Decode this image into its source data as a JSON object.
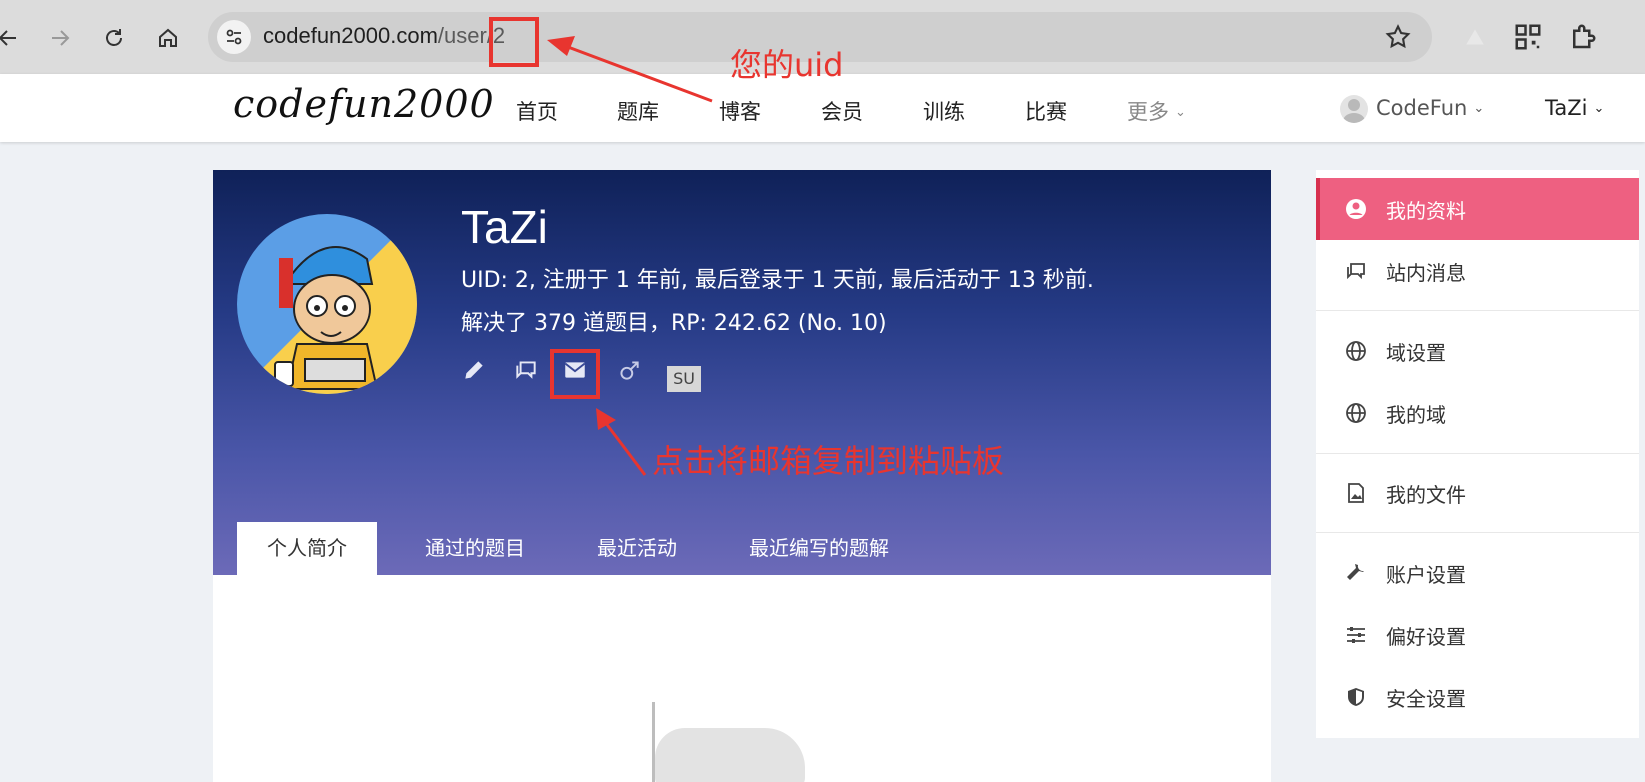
{
  "browser": {
    "url_host": "codefun2000.com",
    "url_path": "/user/2"
  },
  "site": {
    "logo": "codefun2000",
    "nav": [
      {
        "label": "首页"
      },
      {
        "label": "题库"
      },
      {
        "label": "博客"
      },
      {
        "label": "会员"
      },
      {
        "label": "训练"
      },
      {
        "label": "比赛"
      },
      {
        "label": "更多"
      }
    ],
    "domain_menu": "CodeFun",
    "user_menu": "TaZi"
  },
  "profile": {
    "name": "TaZi",
    "info_line": "UID: 2, 注册于 1 年前, 最后登录于 1 天前, 最后活动于 13 秒前.",
    "stats_line": "解决了 379 道题目，RP: 242.62 (No. 10)",
    "badge": "SU",
    "tabs": [
      {
        "label": "个人简介"
      },
      {
        "label": "通过的题目"
      },
      {
        "label": "最近活动"
      },
      {
        "label": "最近编写的题解"
      }
    ]
  },
  "side_menu": [
    {
      "label": "我的资料",
      "icon": "account-circle-icon"
    },
    {
      "label": "站内消息",
      "icon": "message-icon"
    },
    {
      "label": "域设置",
      "icon": "globe-icon"
    },
    {
      "label": "我的域",
      "icon": "globe-icon"
    },
    {
      "label": "我的文件",
      "icon": "file-image-icon"
    },
    {
      "label": "账户设置",
      "icon": "wrench-icon"
    },
    {
      "label": "偏好设置",
      "icon": "sliders-icon"
    },
    {
      "label": "安全设置",
      "icon": "shield-icon"
    }
  ],
  "annotations": {
    "uid_note": "您的uid",
    "email_note": "点击将邮箱复制到粘贴板"
  },
  "colors": {
    "accent": "#ee6081",
    "annotation": "#e8352f",
    "banner_top": "#0f2158",
    "banner_bottom": "#6c6ab8"
  }
}
